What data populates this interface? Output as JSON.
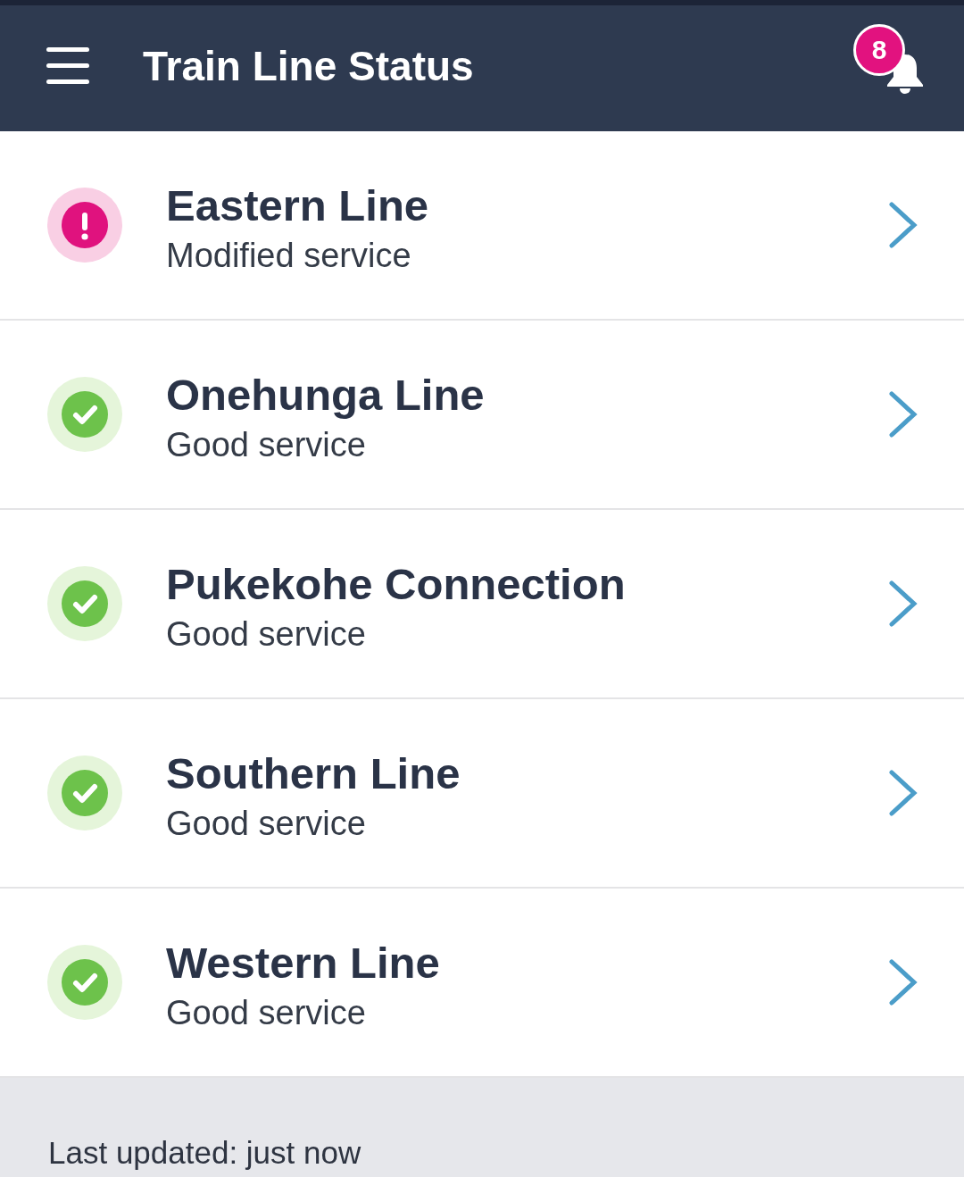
{
  "app_bar": {
    "title": "Train Line Status",
    "notification_count": "8"
  },
  "lines": [
    {
      "name": "Eastern Line",
      "status": "Modified service",
      "kind": "alert"
    },
    {
      "name": "Onehunga Line",
      "status": "Good service",
      "kind": "ok"
    },
    {
      "name": "Pukekohe Connection",
      "status": "Good service",
      "kind": "ok"
    },
    {
      "name": "Southern Line",
      "status": "Good service",
      "kind": "ok"
    },
    {
      "name": "Western Line",
      "status": "Good service",
      "kind": "ok"
    }
  ],
  "footer": {
    "last_updated": "Last updated: just now"
  }
}
